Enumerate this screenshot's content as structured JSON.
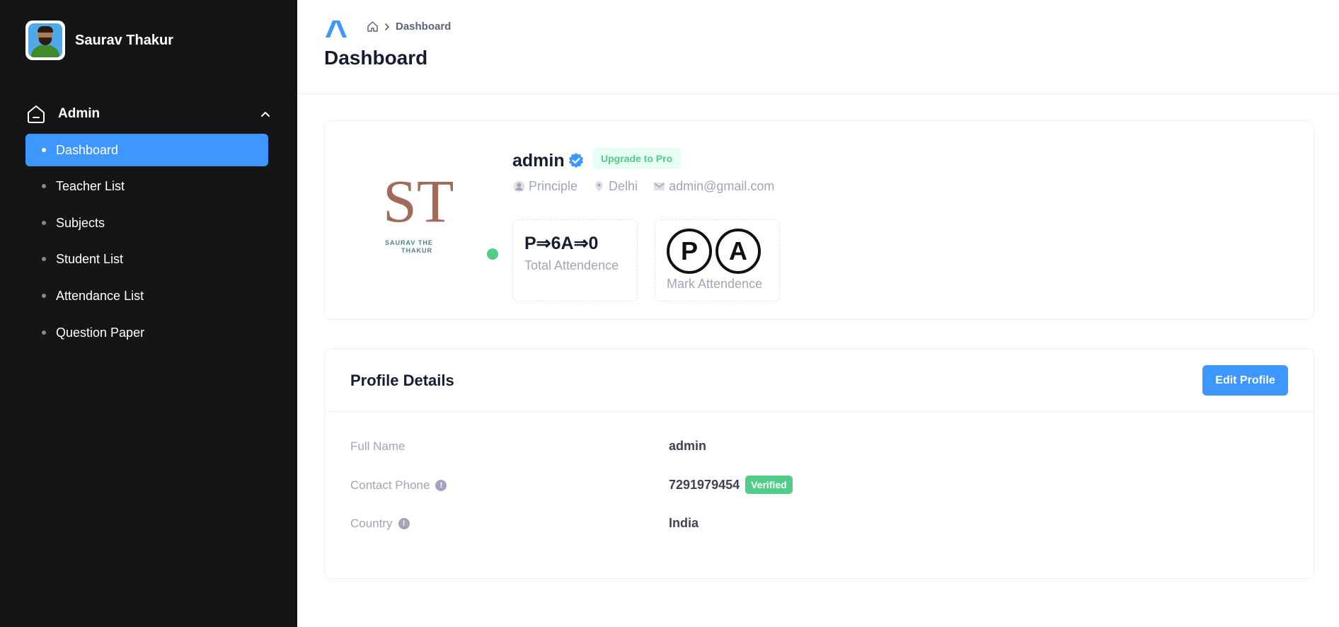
{
  "sidebar": {
    "user_name": "Saurav Thakur",
    "section_label": "Admin",
    "items": [
      {
        "label": "Dashboard",
        "active": true
      },
      {
        "label": "Teacher List"
      },
      {
        "label": "Subjects"
      },
      {
        "label": "Student List"
      },
      {
        "label": "Attendance List"
      },
      {
        "label": "Question Paper"
      }
    ]
  },
  "header": {
    "breadcrumb": "Dashboard",
    "title": "Dashboard"
  },
  "profile": {
    "logo_text_top": "ST",
    "logo_text_bottom_1": "SAURAV THE",
    "logo_text_bottom_2": "THAKUR",
    "name": "admin",
    "upgrade_label": "Upgrade to Pro",
    "role": "Principle",
    "location": "Delhi",
    "email": "admin@gmail.com",
    "attendance_value": "P⇒6A⇒0",
    "attendance_label": "Total Attendence",
    "mark_p": "P",
    "mark_a": "A",
    "mark_label": "Mark Attendence"
  },
  "details": {
    "title": "Profile Details",
    "edit_label": "Edit Profile",
    "rows": [
      {
        "label": "Full Name",
        "value": "admin"
      },
      {
        "label": "Contact Phone",
        "value": "7291979454",
        "badge": "Verified"
      },
      {
        "label": "Country",
        "value": "India"
      }
    ]
  },
  "colors": {
    "sidebar_bg": "#151515",
    "primary": "#3e97ff",
    "success": "#50cd89",
    "muted": "#a1a5b7"
  }
}
